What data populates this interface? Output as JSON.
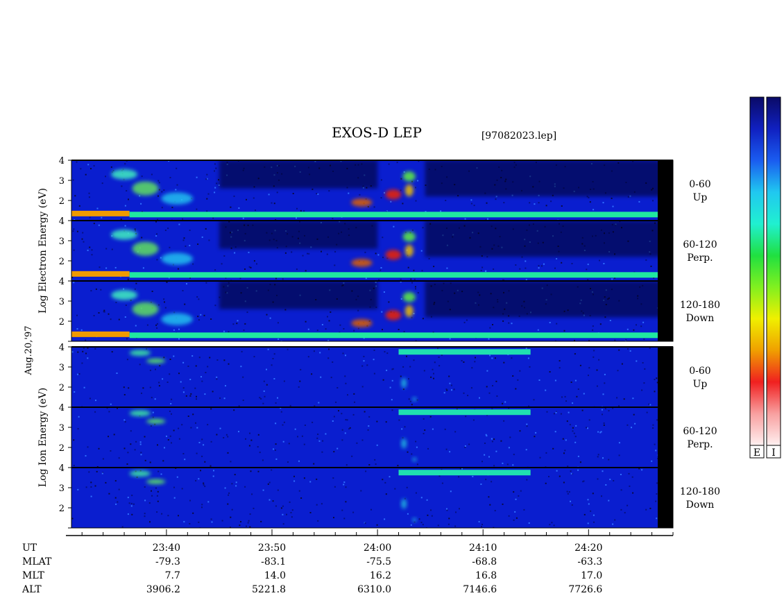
{
  "title": "EXOS-D LEP",
  "filename": "[97082023.lep]",
  "date_label": "Aug.20,'97",
  "colors": {
    "panel_background": "#0a1ecf",
    "sweep_base": "#1230e6",
    "void": "#050520",
    "divider_line": "#000000",
    "gap": "#000000"
  },
  "colorbars": [
    {
      "label": "E"
    },
    {
      "label": "I"
    }
  ],
  "colorbar_colors": [
    "#0a0a66",
    "#1020c0",
    "#1a5cf0",
    "#20c8f0",
    "#20f0d0",
    "#20e040",
    "#80f020",
    "#f0f000",
    "#f0a000",
    "#f02020",
    "#f8a0a0",
    "#fff0f0"
  ],
  "chart_data": {
    "type": "heatmap",
    "x_axis": {
      "label": "UT",
      "tick_labels": [
        "23:40",
        "23:50",
        "24:00",
        "24:10",
        "24:20"
      ],
      "major_ticks_min": [
        1420,
        1430,
        1440,
        1450,
        1460
      ],
      "minor_tick_interval_min": 2,
      "range_min": [
        1411,
        1468
      ]
    },
    "orbit_rows": [
      {
        "label": "MLAT",
        "values": [
          "-79.3",
          "-83.1",
          "-75.5",
          "-68.8",
          "-63.3"
        ]
      },
      {
        "label": "MLT",
        "values": [
          "7.7",
          "14.0",
          "16.2",
          "16.8",
          "17.0"
        ]
      },
      {
        "label": "ALT",
        "values": [
          "3906.2",
          "5221.8",
          "6310.0",
          "7146.6",
          "7726.6"
        ]
      }
    ],
    "groups": [
      {
        "species": "Electron",
        "ylabel_words": [
          "Log",
          "Electron",
          "Energy",
          "(eV)"
        ],
        "panels": [
          {
            "angle": "0-60",
            "direction": "Up",
            "yticks": [
              "2",
              "3",
              "4"
            ],
            "ylim": [
              1,
              4
            ]
          },
          {
            "angle": "60-120",
            "direction": "Perp.",
            "yticks": [
              "2",
              "3",
              "4"
            ],
            "ylim": [
              1,
              4
            ]
          },
          {
            "angle": "120-180",
            "direction": "Down",
            "yticks": [
              "2",
              "3",
              "4"
            ],
            "ylim": [
              1,
              4
            ]
          }
        ]
      },
      {
        "species": "Ion",
        "ylabel_words": [
          "Log",
          "Ion",
          "Energy",
          "(eV)"
        ],
        "panels": [
          {
            "angle": "0-60",
            "direction": "Up",
            "yticks": [
              "2",
              "3",
              "4"
            ],
            "ylim": [
              1,
              4
            ]
          },
          {
            "angle": "60-120",
            "direction": "Perp.",
            "yticks": [
              "2",
              "3",
              "4"
            ],
            "ylim": [
              1,
              4
            ]
          },
          {
            "angle": "120-180",
            "direction": "Down",
            "yticks": [
              "2",
              "3",
              "4"
            ],
            "ylim": [
              1,
              4
            ]
          }
        ]
      }
    ],
    "features": {
      "electron": [
        {
          "kind": "band",
          "t_start": 1411,
          "t_end": 1416.5,
          "log_e": 1.35,
          "color": "#f09a00"
        },
        {
          "kind": "band",
          "t_start": 1416.5,
          "t_end": 1467.5,
          "log_e": 1.3,
          "color": "#20e8a0"
        },
        {
          "kind": "blob",
          "t": 1416,
          "log_e": 3.3,
          "dt": 2.5,
          "de": 0.5,
          "color": "#40f0c0"
        },
        {
          "kind": "blob",
          "t": 1418,
          "log_e": 2.6,
          "dt": 2.5,
          "de": 0.7,
          "color": "#60e060"
        },
        {
          "kind": "blob",
          "t": 1421,
          "log_e": 2.1,
          "dt": 3,
          "de": 0.6,
          "color": "#20c0f0"
        },
        {
          "kind": "blob",
          "t": 1438.5,
          "log_e": 1.9,
          "dt": 2,
          "de": 0.4,
          "color": "#e06000"
        },
        {
          "kind": "blob",
          "t": 1441.5,
          "log_e": 2.3,
          "dt": 1.5,
          "de": 0.5,
          "color": "#f02000"
        },
        {
          "kind": "blob",
          "t": 1443,
          "log_e": 3.2,
          "dt": 1.2,
          "de": 0.5,
          "color": "#60f040"
        },
        {
          "kind": "blob",
          "t": 1443,
          "log_e": 2.5,
          "dt": 0.8,
          "de": 0.6,
          "color": "#f0c000"
        },
        {
          "kind": "void",
          "t_start": 1425,
          "t_end": 1440,
          "log_e_low": 2.6,
          "log_e_high": 4
        },
        {
          "kind": "void",
          "t_start": 1444.5,
          "t_end": 1467.5,
          "log_e_low": 2.2,
          "log_e_high": 4
        }
      ],
      "ion": [
        {
          "kind": "blob",
          "t": 1417.5,
          "log_e": 3.7,
          "dt": 2,
          "de": 0.3,
          "color": "#40f0a0"
        },
        {
          "kind": "blob",
          "t": 1419,
          "log_e": 3.3,
          "dt": 1.8,
          "de": 0.25,
          "color": "#60f060"
        },
        {
          "kind": "band",
          "t_start": 1442,
          "t_end": 1454.5,
          "log_e": 3.75,
          "color": "#20e0b0"
        },
        {
          "kind": "blob",
          "t": 1442.5,
          "log_e": 2.2,
          "dt": 0.5,
          "de": 0.5,
          "color": "#20c0e0"
        },
        {
          "kind": "blob",
          "t": 1443.5,
          "log_e": 1.4,
          "dt": 0.4,
          "de": 0.2,
          "color": "#20c0e0"
        }
      ]
    }
  }
}
